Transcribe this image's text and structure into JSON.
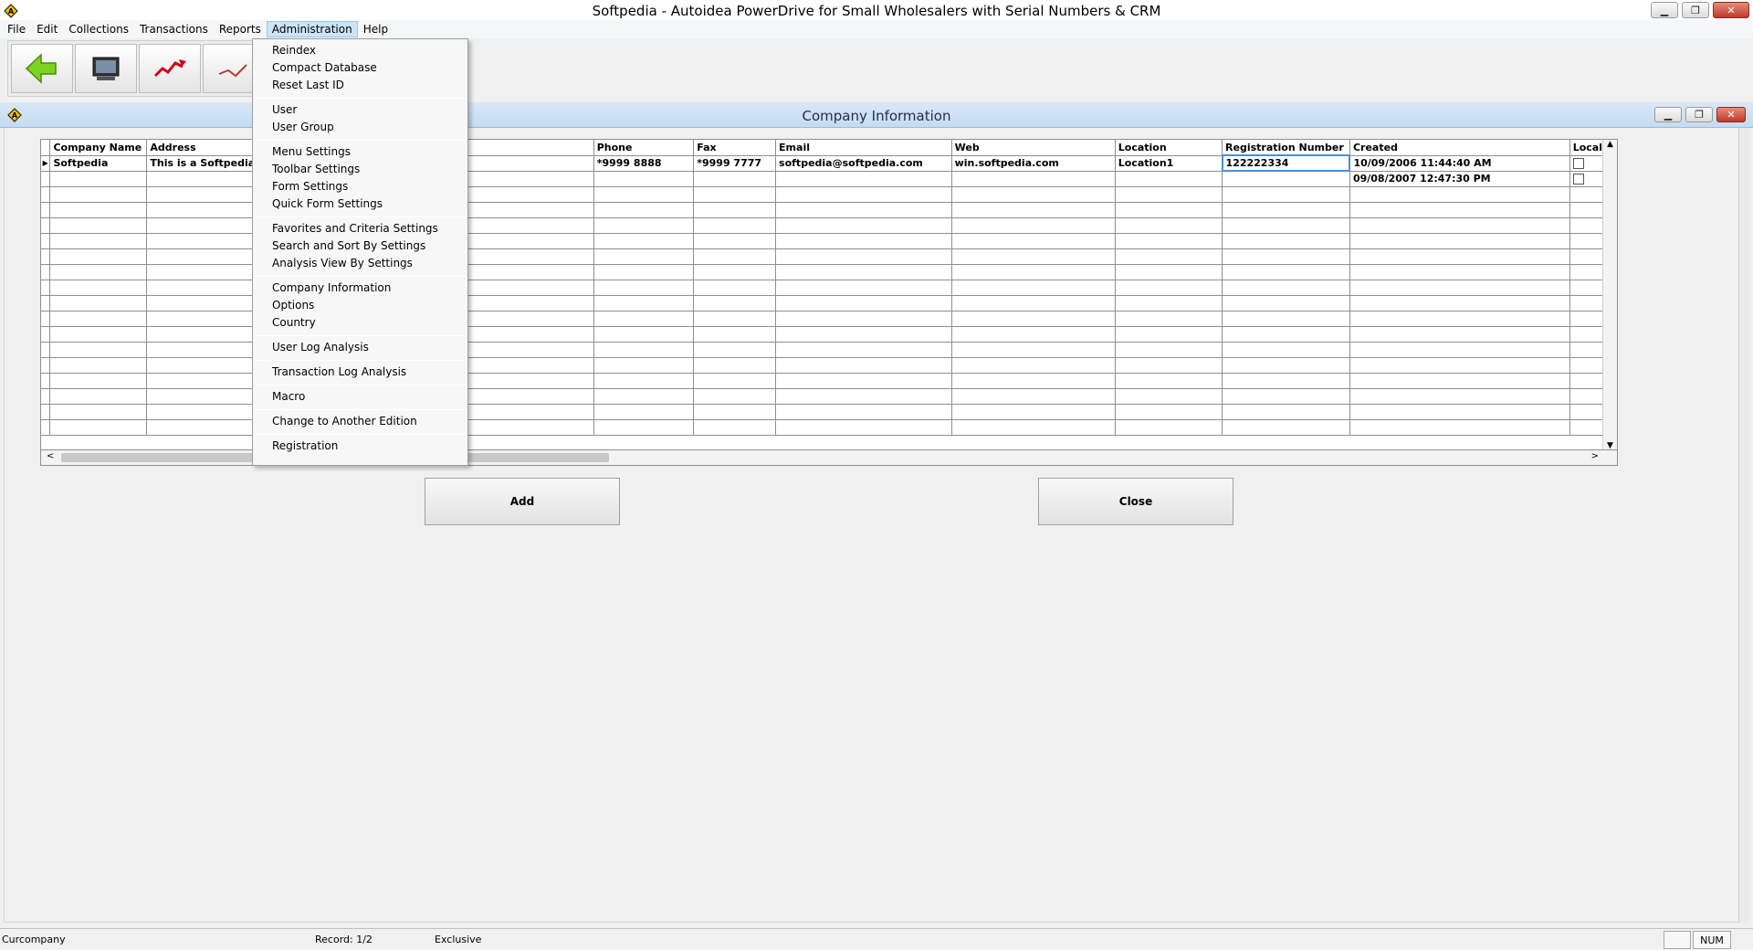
{
  "window": {
    "title": "Softpedia - Autoidea PowerDrive for Small Wholesalers with Serial Numbers & CRM"
  },
  "menubar": [
    "File",
    "Edit",
    "Collections",
    "Transactions",
    "Reports",
    "Administration",
    "Help"
  ],
  "inner_window": {
    "title": "Company Information"
  },
  "grid": {
    "columns": [
      "Company Name",
      "Address",
      "",
      "Phone",
      "Fax",
      "Email",
      "Web",
      "Location",
      "Registration Number",
      "Created",
      "Local P"
    ],
    "rows": [
      [
        "Softpedia",
        "This is a Softpedia to",
        "",
        "*9999 8888",
        "*9999 7777",
        "softpedia@softpedia.com",
        "win.softpedia.com",
        "Location1",
        "122222334",
        "10/09/2006 11:44:40 AM",
        ""
      ],
      [
        "",
        "",
        "",
        "",
        "",
        "",
        "",
        "",
        "",
        "09/08/2007 12:47:30 PM",
        ""
      ]
    ]
  },
  "buttons": {
    "add": "Add",
    "close": "Close"
  },
  "admin_menu": {
    "groups": [
      [
        "Reindex",
        "Compact Database",
        "Reset Last ID"
      ],
      [
        "User",
        "User Group"
      ],
      [
        "Menu Settings",
        "Toolbar Settings",
        "Form Settings",
        "Quick Form Settings"
      ],
      [
        "Favorites and Criteria Settings",
        "Search and Sort By Settings",
        "Analysis View By Settings"
      ],
      [
        "Company Information",
        "Options",
        "Country"
      ],
      [
        "User Log Analysis"
      ],
      [
        "Transaction Log Analysis"
      ],
      [
        "Macro"
      ],
      [
        "Change to Another Edition"
      ],
      [
        "Registration"
      ]
    ]
  },
  "statusbar": {
    "company": "Curcompany",
    "record": "Record: 1/2",
    "mode": "Exclusive",
    "num": "NUM"
  },
  "toolbar": [
    "back-arrow-icon",
    "monitor-icon",
    "chart-icon",
    "graph-icon",
    "keyboard-icon",
    "person-icon"
  ]
}
